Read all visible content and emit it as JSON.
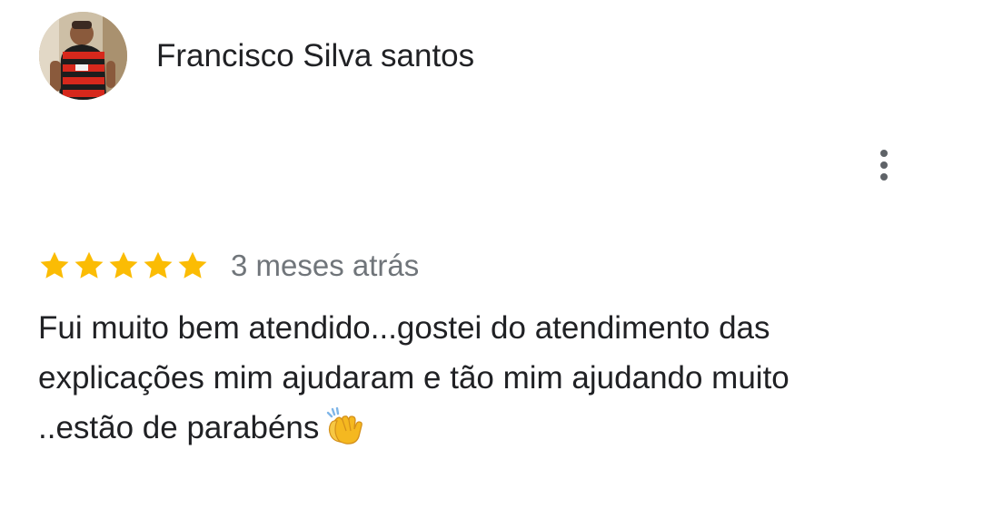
{
  "review": {
    "author_name": "Francisco Silva santos",
    "rating": 5,
    "rating_max": 5,
    "time_ago": "3 meses atrás",
    "text_lines": [
      "Fui muito bem atendido...gostei do atendimento das",
      "explicações mim ajudaram e tão mim ajudando muito",
      "..estão de parabéns"
    ],
    "emoji": "clapping-hands"
  },
  "colors": {
    "star": "#fbbc04",
    "text": "#202124",
    "secondary_text": "#70757a",
    "menu_dots": "#5f6368"
  },
  "icons": {
    "menu": "more-vert-icon",
    "star": "star-icon",
    "avatar": "user-avatar-photo"
  }
}
